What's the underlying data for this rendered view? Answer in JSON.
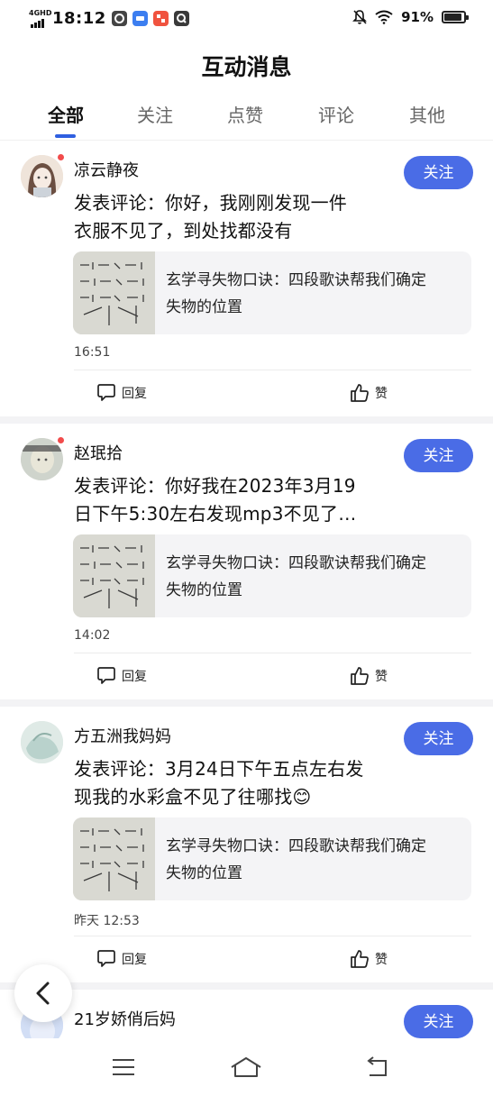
{
  "status_bar": {
    "network": "4GHD",
    "time": "18:12",
    "battery": "91%",
    "battery_level": 0.91,
    "app_icons": [
      "app-icon-1",
      "app-icon-2",
      "app-icon-3",
      "app-icon-4"
    ]
  },
  "header": {
    "title": "互动消息",
    "tabs": [
      {
        "label": "全部",
        "active": true
      },
      {
        "label": "关注",
        "active": false
      },
      {
        "label": "点赞",
        "active": false
      },
      {
        "label": "评论",
        "active": false
      },
      {
        "label": "其他",
        "active": false
      }
    ]
  },
  "messages": [
    {
      "username": "凉云静夜",
      "follow_label": "关注",
      "unread": true,
      "comment_line1": "发表评论：你好，我刚刚发现一件",
      "comment_line2": "衣服不见了，到处找都没有",
      "article_line1": "玄学寻失物口诀：四段歌诀帮我们确定",
      "article_line2": "失物的位置",
      "time": "16:51",
      "reply_label": "回复",
      "like_label": "赞"
    },
    {
      "username": "赵珉拾",
      "follow_label": "关注",
      "unread": true,
      "comment_line1": "发表评论：你好我在2023年3月19",
      "comment_line2": "日下午5:30左右发现mp3不见了…",
      "article_line1": "玄学寻失物口诀：四段歌诀帮我们确定",
      "article_line2": "失物的位置",
      "time": "14:02",
      "reply_label": "回复",
      "like_label": "赞"
    },
    {
      "username": "方五洲我妈妈",
      "follow_label": "关注",
      "unread": false,
      "comment_line1": "发表评论：3月24日下午五点左右发",
      "comment_line2": "现我的水彩盒不见了往哪找😊",
      "article_line1": "玄学寻失物口诀：四段歌诀帮我们确定",
      "article_line2": "失物的位置",
      "time": "昨天 12:53",
      "reply_label": "回复",
      "like_label": "赞"
    },
    {
      "username": "21岁娇俏后妈",
      "follow_label": "关注",
      "unread": false
    }
  ],
  "colors": {
    "accent": "#4a6ce6",
    "tab_indicator": "#2f5fe0",
    "unread_dot": "#f24b4b"
  }
}
